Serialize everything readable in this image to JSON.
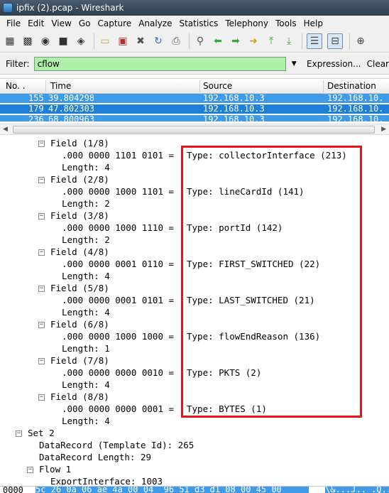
{
  "window": {
    "title": "ipfix (2).pcap - Wireshark"
  },
  "menu": [
    "File",
    "Edit",
    "View",
    "Go",
    "Capture",
    "Analyze",
    "Statistics",
    "Telephony",
    "Tools",
    "Help"
  ],
  "filter": {
    "label": "Filter:",
    "value": "cflow",
    "expression_label": "Expression...",
    "clear_label": "Clear"
  },
  "packet_list": {
    "columns": [
      "No. .",
      "Time",
      "Source",
      "Destination"
    ],
    "rows": [
      {
        "no": "155",
        "time": "39.804298",
        "source": "192.168.10.3",
        "destination": "192.168.10."
      },
      {
        "no": "179",
        "time": "47.802303",
        "source": "192.168.10.3",
        "destination": "192.168.10."
      },
      {
        "no": "236",
        "time": "68.800963",
        "source": "192.168.10.3",
        "destination": "192.168.10."
      }
    ]
  },
  "details": {
    "fields": [
      {
        "field": "Field (1/8)",
        "bits": ".000 0000 1101 0101 = ",
        "type": "Type: collectorInterface (213)",
        "length": "Length: 4"
      },
      {
        "field": "Field (2/8)",
        "bits": ".000 0000 1000 1101 = ",
        "type": "Type: lineCardId (141)",
        "length": "Length: 2"
      },
      {
        "field": "Field (3/8)",
        "bits": ".000 0000 1000 1110 = ",
        "type": "Type: portId (142)",
        "length": "Length: 2"
      },
      {
        "field": "Field (4/8)",
        "bits": ".000 0000 0001 0110 = ",
        "type": "Type: FIRST_SWITCHED (22)",
        "length": "Length: 4"
      },
      {
        "field": "Field (5/8)",
        "bits": ".000 0000 0001 0101 = ",
        "type": "Type: LAST_SWITCHED (21)",
        "length": "Length: 4"
      },
      {
        "field": "Field (6/8)",
        "bits": ".000 0000 1000 1000 = ",
        "type": "Type: flowEndReason (136)",
        "length": "Length: 1"
      },
      {
        "field": "Field (7/8)",
        "bits": ".000 0000 0000 0010 = ",
        "type": "Type: PKTS (2)",
        "length": "Length: 4"
      },
      {
        "field": "Field (8/8)",
        "bits": ".000 0000 0000 0001 = ",
        "type": "Type: BYTES (1)",
        "length": "Length: 4"
      }
    ],
    "set2": "Set 2",
    "datarecord_template": "DataRecord (Template Id): 265",
    "datarecord_length": "DataRecord Length: 29",
    "flow1": "Flow 1",
    "export_interface": "ExportInterface: 1003"
  },
  "hex": {
    "offset": "0000",
    "bytes": "5c 26 0a 06 ae 4a 00 04  96 51 d3 d1 08 00 45 00",
    "ascii": "\\&...J.. .Q....E."
  },
  "colors": {
    "selection": "#3f9ae8",
    "filter_ok": "#aff0a8",
    "highlight_box": "#e8141a"
  }
}
